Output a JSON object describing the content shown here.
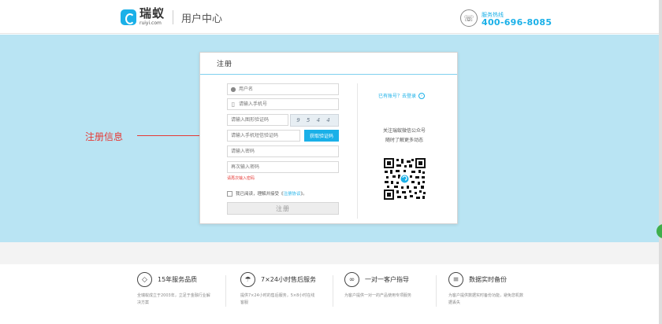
{
  "header": {
    "logo_cn": "瑞蚁",
    "logo_en": "ruiyi.com",
    "title": "用户中心",
    "hotline_label": "服务热线",
    "hotline_number": "400-696-8085",
    "phone_icon": "phone-icon"
  },
  "annotation": {
    "label": "注册信息",
    "color": "#e53935"
  },
  "register": {
    "title": "注册",
    "username_placeholder": "用户名",
    "phone_placeholder": "请输入手机号",
    "captcha_placeholder": "请输入图形验证码",
    "captcha_text": "9 5 4 4",
    "sms_placeholder": "请输入手机短信验证码",
    "sms_button": "获取验证码",
    "password_placeholder": "请输入密码",
    "password_confirm_placeholder": "再次输入密码",
    "error": "请再次输入密码",
    "agree_prefix": "我已阅读，理解并接受《",
    "agree_link": "注册协议",
    "agree_suffix": "》。",
    "submit": "注册"
  },
  "side": {
    "login_text": "已有账号？去登录",
    "wechat_line1": "关注瑞蚁微信公众号",
    "wechat_line2": "随时了解更多动态"
  },
  "features": [
    {
      "icon": "diamond-icon",
      "title": "15年服务品质",
      "desc": "全瑞蚁成立于2003年，立足于金融行业解决方案"
    },
    {
      "icon": "umbrella-icon",
      "title": "7×24小时售后服务",
      "desc": "提供7×24小时的售后服务，5×8小时在线客服"
    },
    {
      "icon": "handshake-icon",
      "title": "一对一客户指导",
      "desc": "为客户提供一对一的产品使用专项服务"
    },
    {
      "icon": "backup-icon",
      "title": "数据实时备份",
      "desc": "为客户提供数据实时备份功能，避免您机数据丢失"
    }
  ],
  "colors": {
    "accent": "#1ab0e8",
    "banner": "#b9e4f3",
    "error": "#e53935"
  }
}
